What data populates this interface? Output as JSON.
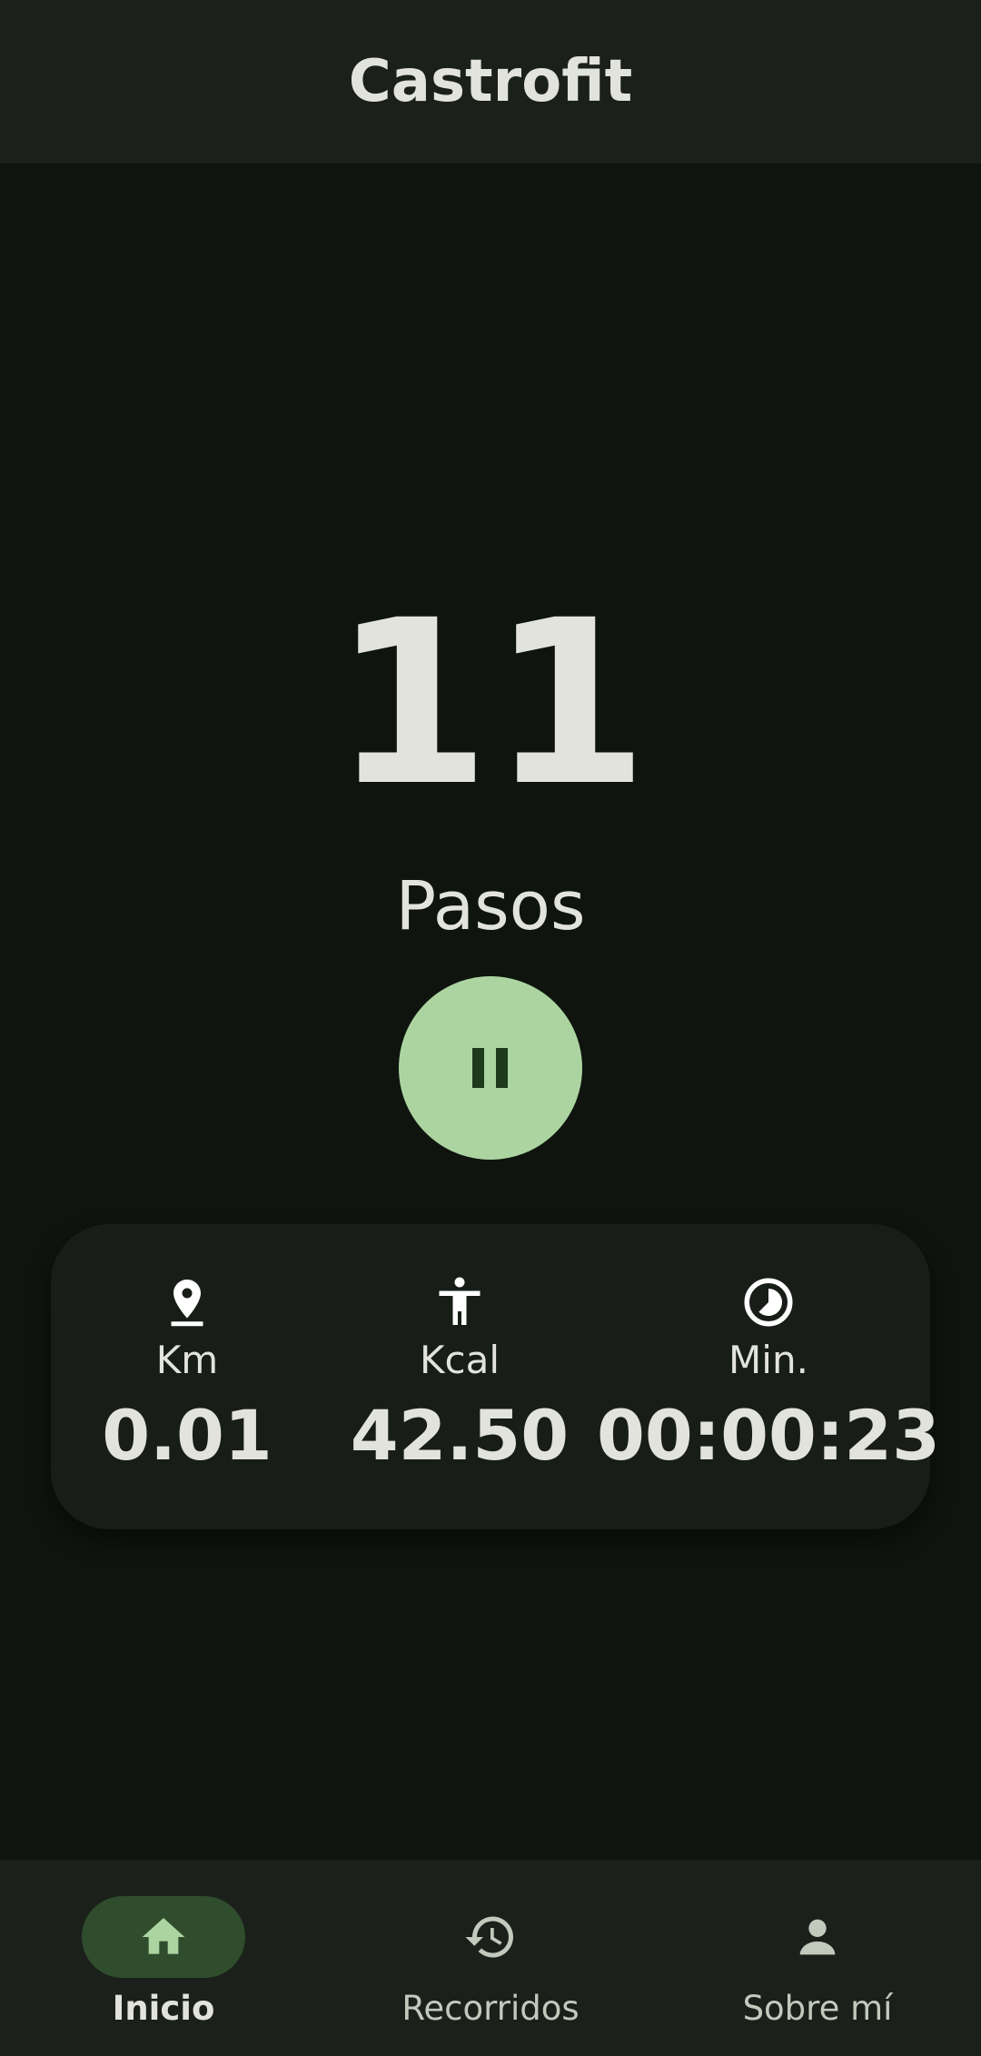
{
  "header": {
    "title": "Castrofit"
  },
  "counter": {
    "steps": "11",
    "label": "Pasos"
  },
  "controls": {
    "pause_icon": "pause-icon"
  },
  "stats": {
    "km": {
      "label": "Km",
      "value": "0.01",
      "icon": "location-pin-icon"
    },
    "kcal": {
      "label": "Kcal",
      "value": "42.50",
      "icon": "person-standing-icon"
    },
    "min": {
      "label": "Min.",
      "value": "00:00:23",
      "icon": "timelapse-icon"
    }
  },
  "nav": {
    "items": [
      {
        "label": "Inicio",
        "icon": "home-icon",
        "active": true
      },
      {
        "label": "Recorridos",
        "icon": "history-icon",
        "active": false
      },
      {
        "label": "Sobre mí",
        "icon": "person-icon",
        "active": false
      }
    ]
  },
  "colors": {
    "background": "#0f140f",
    "surface": "#1b201b",
    "card": "#181d18",
    "accent": "#acd4a0",
    "accent_dark": "#1d3a1c",
    "nav_active_pill": "#2f4d2c",
    "nav_active_icon": "#acd4a0",
    "text": "#e2e3dc"
  }
}
